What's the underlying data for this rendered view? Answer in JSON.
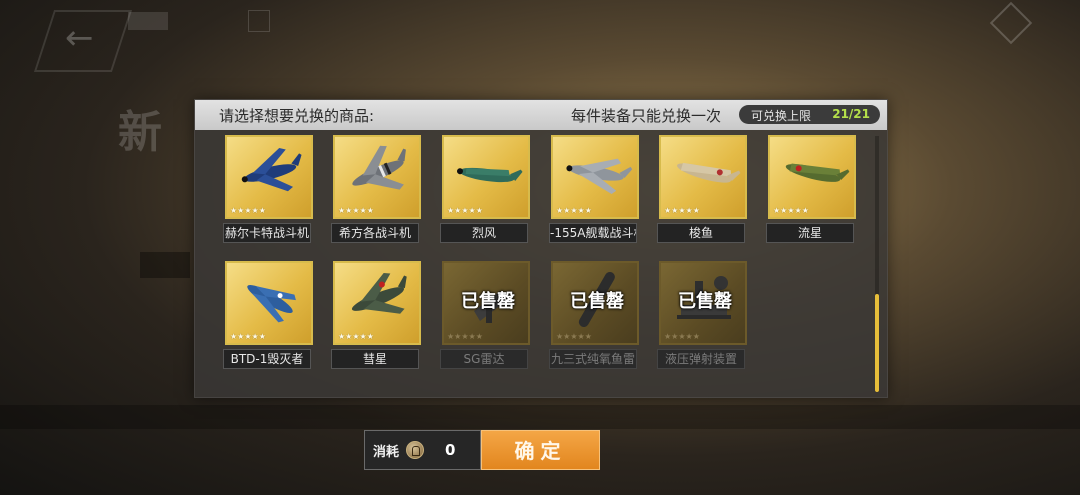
{
  "header": {
    "instruction": "请选择想要兑换的商品:",
    "notice": "每件装备只能兑换一次",
    "limit_label": "可兑换上限",
    "limit_value": "21/21"
  },
  "items_row1": [
    {
      "name": "赫尔卡特战斗机",
      "stars": "★★★★★",
      "icon": "plane-navy-blue-icon",
      "colors": {
        "body": "#1f3c7a",
        "wing": "#2b4f98"
      }
    },
    {
      "name": "希方各战斗机",
      "stars": "★★★★★",
      "icon": "plane-grey-striped-icon",
      "colors": {
        "body": "#6e7278",
        "wing": "#8a8e93"
      }
    },
    {
      "name": "烈风",
      "stars": "★★★★★",
      "icon": "plane-green-icon",
      "colors": {
        "body": "#2f6b5a",
        "wing": "#3a7d68"
      }
    },
    {
      "name": "-155A舰载战斗机",
      "stars": "★★★★★",
      "icon": "plane-silver-icon",
      "colors": {
        "body": "#8f959c",
        "wing": "#a8adb3"
      }
    },
    {
      "name": "梭鱼",
      "stars": "★★★★★",
      "icon": "plane-tan-icon",
      "colors": {
        "body": "#c8b690",
        "wing": "#d6c7a5"
      }
    },
    {
      "name": "流星",
      "stars": "★★★★★",
      "icon": "plane-olive-icon",
      "colors": {
        "body": "#556b2f",
        "wing": "#6a8038"
      }
    }
  ],
  "items_row2": [
    {
      "name": "BTD-1毁灭者",
      "stars": "★★★★★",
      "icon": "plane-blue-icon",
      "colors": {
        "body": "#2d5e9e",
        "wing": "#3a6fb3"
      },
      "sold": false
    },
    {
      "name": "彗星",
      "stars": "★★★★★",
      "icon": "plane-dark-green-icon",
      "colors": {
        "body": "#3c4a3a",
        "wing": "#4b5c47"
      },
      "sold": false
    },
    {
      "name": "SG雷达",
      "stars": "★★★★★",
      "icon": "radar-icon",
      "sold": true,
      "sold_label": "已售罄"
    },
    {
      "name": "九三式纯氧鱼雷",
      "stars": "★★★★★",
      "icon": "torpedo-icon",
      "sold": true,
      "sold_label": "已售罄"
    },
    {
      "name": "液压弹射装置",
      "stars": "★★★★★",
      "icon": "catapult-icon",
      "sold": true,
      "sold_label": "已售罄"
    }
  ],
  "bottom": {
    "cost_label": "消耗",
    "cost_value": "0",
    "confirm_label": "确定"
  },
  "colors": {
    "accent_gold": "#e7be3a",
    "limit_green": "#b4e04a",
    "confirm_orange": "#e2861e"
  }
}
